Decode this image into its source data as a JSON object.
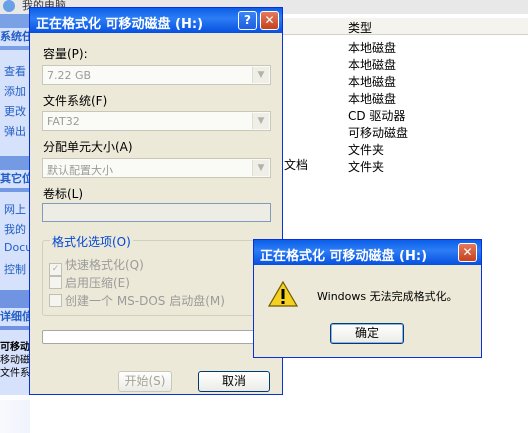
{
  "explorer": {
    "title": "我的电脑",
    "pane": {
      "head1": "系统任务",
      "links1": [
        "查看",
        "添加",
        "更改",
        "弹出"
      ],
      "head2": "其它位置",
      "links2": [
        "网上",
        "我的",
        "Docu",
        "控制"
      ],
      "head3": "详细信息",
      "details": [
        "可移动磁",
        "移动磁",
        "文件系统"
      ]
    },
    "column_type": "类型",
    "types": [
      "本地磁盘",
      "本地磁盘",
      "本地磁盘",
      "本地磁盘",
      "CD 驱动器",
      "可移动磁盘",
      "文件夹",
      "文件夹"
    ],
    "stray": "文档"
  },
  "format_dialog": {
    "title": "正在格式化 可移动磁盘 (H:)",
    "help": "?",
    "close": "✕",
    "capacity_label": "容量(P):",
    "capacity_value": "7.22 GB",
    "fs_label": "文件系统(F)",
    "fs_value": "FAT32",
    "alloc_label": "分配单元大小(A)",
    "alloc_value": "默认配置大小",
    "volume_label": "卷标(L)",
    "volume_value": "",
    "options_legend": "格式化选项(O)",
    "quick_format": "快速格式化(Q)",
    "compression": "启用压缩(E)",
    "msdos": "创建一个 MS-DOS 启动盘(M)",
    "start": "开始(S)",
    "cancel": "取消"
  },
  "message_box": {
    "title": "正在格式化 可移动磁盘 (H:)",
    "close": "✕",
    "text": "Windows 无法完成格式化。",
    "ok": "确定"
  },
  "icons": {
    "warning": "warning-icon",
    "drive": "computer-icon"
  },
  "colors": {
    "titlebar": "#0a5fe8",
    "dialog_bg": "#ece9d8",
    "link": "#215dc6"
  }
}
